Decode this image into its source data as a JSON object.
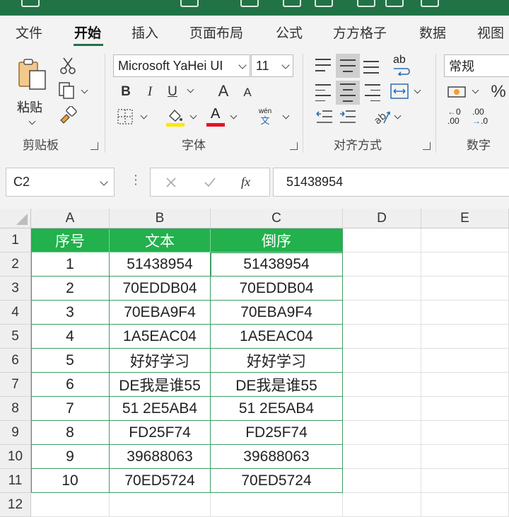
{
  "ribbon_tabs": [
    "文件",
    "开始",
    "插入",
    "页面布局",
    "公式",
    "方方格子",
    "数据",
    "视图"
  ],
  "active_tab": "开始",
  "clipboard": {
    "paste_label": "粘贴",
    "group_label": "剪贴板"
  },
  "font": {
    "name": "Microsoft YaHei UI",
    "size": "11",
    "bold": "B",
    "italic": "I",
    "underline": "U",
    "grow": "A",
    "shrink": "A",
    "color_glyph": "A",
    "phonetic_top": "wén",
    "phonetic_bottom": "文",
    "group_label": "字体",
    "fill_color": "#ffe600",
    "font_color": "#e81123"
  },
  "alignment": {
    "group_label": "对齐方式",
    "wrap_glyph": "ab"
  },
  "number": {
    "format": "常规",
    "percent": "%",
    "group_label": "数字",
    "inc_decimal": ".00",
    "dec_decimal": ".00"
  },
  "formula_bar": {
    "name_box": "C2",
    "fx": "fx",
    "value": "51438954"
  },
  "sheet": {
    "columns": [
      "A",
      "B",
      "C",
      "D",
      "E"
    ],
    "rows": [
      "1",
      "2",
      "3",
      "4",
      "5",
      "6",
      "7",
      "8",
      "9",
      "10",
      "11",
      "12"
    ],
    "header": [
      "序号",
      "文本",
      "倒序"
    ],
    "data": [
      [
        "1",
        "51438954",
        "51438954"
      ],
      [
        "2",
        "70EDDB04",
        "70EDDB04"
      ],
      [
        "3",
        "70EBA9F4",
        "70EBA9F4"
      ],
      [
        "4",
        "1A5EAC04",
        "1A5EAC04"
      ],
      [
        "5",
        "好好学习",
        "好好学习"
      ],
      [
        "6",
        "DE我是谁55",
        "DE我是谁55"
      ],
      [
        "7",
        "51 2E5AB4",
        "51 2E5AB4"
      ],
      [
        "8",
        "FD25F74",
        "FD25F74"
      ],
      [
        "9",
        "39688063",
        "39688063"
      ],
      [
        "10",
        "70ED5724",
        "70ED5724"
      ]
    ],
    "header_color": "#22b14c"
  }
}
